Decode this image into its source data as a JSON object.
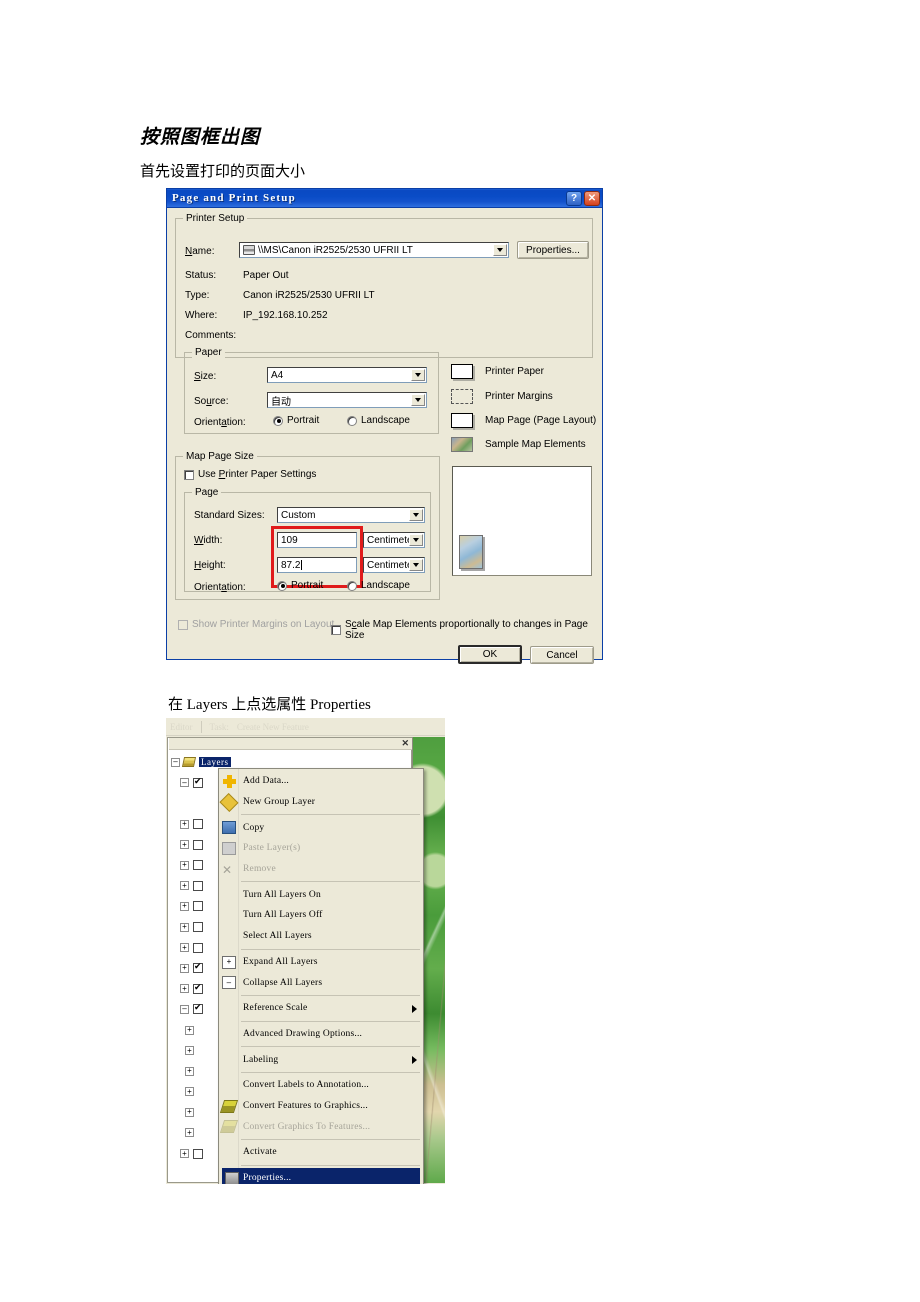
{
  "document": {
    "title": "按照图框出图",
    "line1": "首先设置打印的页面大小",
    "line2": "在 Layers 上点选属性 Properties"
  },
  "dialog": {
    "title": "Page and Print Setup",
    "help_button": "?",
    "close_button": "✕",
    "printer_setup": {
      "group_label": "Printer Setup",
      "name_label": "Name:",
      "name_value": "\\\\MS\\Canon iR2525/2530 UFRII LT",
      "properties_button": "Properties...",
      "status_label": "Status:",
      "status_value": "Paper Out",
      "type_label": "Type:",
      "type_value": "Canon iR2525/2530 UFRII LT",
      "where_label": "Where:",
      "where_value": "IP_192.168.10.252",
      "comments_label": "Comments:",
      "comments_value": ""
    },
    "paper": {
      "group_label": "Paper",
      "size_label": "Size:",
      "size_value": "A4",
      "source_label": "Source:",
      "source_value": "自动",
      "orientation_label": "Orientation:",
      "portrait_label": "Portrait",
      "landscape_label": "Landscape",
      "orientation_selected": "Portrait"
    },
    "legend": {
      "printer_paper": "Printer Paper",
      "printer_margins": "Printer Margins",
      "map_page": "Map Page (Page Layout)",
      "sample_map_elements": "Sample Map Elements"
    },
    "map_page_size": {
      "group_label": "Map Page Size",
      "use_printer_paper_settings": "Use Printer Paper Settings",
      "use_printer_paper_checked": false,
      "page_group_label": "Page",
      "standard_sizes_label": "Standard Sizes:",
      "standard_sizes_value": "Custom",
      "width_label": "Width:",
      "width_value": "109",
      "width_units": "Centimeters",
      "height_label": "Height:",
      "height_value": "87.2",
      "height_units": "Centimeters",
      "orientation_label": "Orientation:",
      "portrait_label": "Portrait",
      "landscape_label": "Landscape",
      "orientation_selected": "Portrait"
    },
    "footer": {
      "show_printer_margins": "Show Printer Margins on Layout",
      "show_printer_margins_enabled": false,
      "scale_map_elements": "Scale Map Elements proportionally to changes in Page Size",
      "scale_map_elements_checked": false,
      "ok_button": "OK",
      "cancel_button": "Cancel"
    },
    "highlight_color": "#e01b1b",
    "titlebar_color": "#0a4cc6"
  },
  "arcmap": {
    "toolbar": {
      "editor_label": "Editor",
      "task_label": "Task:",
      "task_value": "Create New Feature"
    },
    "toc": {
      "root_label": "Layers",
      "close_button": "✕",
      "rows": [
        {
          "expander": "−",
          "checkbox": "none",
          "checked": false
        },
        {
          "expander": "−",
          "checkbox": "on",
          "checked": true
        },
        {
          "expander": "",
          "checkbox": "none",
          "checked": false
        },
        {
          "expander": "+",
          "checkbox": "off",
          "checked": false
        },
        {
          "expander": "+",
          "checkbox": "off",
          "checked": false
        },
        {
          "expander": "+",
          "checkbox": "off",
          "checked": false
        },
        {
          "expander": "+",
          "checkbox": "off",
          "checked": false
        },
        {
          "expander": "+",
          "checkbox": "off",
          "checked": false
        },
        {
          "expander": "+",
          "checkbox": "off",
          "checked": false
        },
        {
          "expander": "+",
          "checkbox": "off",
          "checked": false
        },
        {
          "expander": "+",
          "checkbox": "on",
          "checked": true
        },
        {
          "expander": "+",
          "checkbox": "on",
          "checked": true
        },
        {
          "expander": "−",
          "checkbox": "on",
          "checked": true
        },
        {
          "expander": "+",
          "checkbox": "none",
          "checked": false
        },
        {
          "expander": "+",
          "checkbox": "none",
          "checked": false
        },
        {
          "expander": "+",
          "checkbox": "none",
          "checked": false
        },
        {
          "expander": "+",
          "checkbox": "none",
          "checked": false
        },
        {
          "expander": "+",
          "checkbox": "none",
          "checked": false
        },
        {
          "expander": "+",
          "checkbox": "none",
          "checked": false
        },
        {
          "expander": "+",
          "checkbox": "off",
          "checked": false
        }
      ]
    },
    "context_menu": {
      "items": [
        {
          "label": "Add Data...",
          "icon": "add-data-icon",
          "state": "normal",
          "submenu": false
        },
        {
          "label": "New Group Layer",
          "icon": "new-group-layer-icon",
          "state": "normal",
          "submenu": false
        },
        {
          "separator": true
        },
        {
          "label": "Copy",
          "icon": "copy-icon",
          "state": "normal",
          "submenu": false
        },
        {
          "label": "Paste Layer(s)",
          "icon": "paste-icon",
          "state": "disabled",
          "submenu": false
        },
        {
          "label": "Remove",
          "icon": "remove-icon",
          "state": "disabled",
          "submenu": false
        },
        {
          "separator": true
        },
        {
          "label": "Turn All Layers On",
          "icon": "",
          "state": "normal",
          "submenu": false
        },
        {
          "label": "Turn All Layers Off",
          "icon": "",
          "state": "normal",
          "submenu": false
        },
        {
          "label": "Select All Layers",
          "icon": "",
          "state": "normal",
          "submenu": false
        },
        {
          "separator": true
        },
        {
          "label": "Expand All Layers",
          "icon": "expand-all-icon",
          "state": "normal",
          "submenu": false
        },
        {
          "label": "Collapse All Layers",
          "icon": "collapse-all-icon",
          "state": "normal",
          "submenu": false
        },
        {
          "separator": true
        },
        {
          "label": "Reference Scale",
          "icon": "",
          "state": "normal",
          "submenu": true
        },
        {
          "separator": true
        },
        {
          "label": "Advanced Drawing Options...",
          "icon": "",
          "state": "normal",
          "submenu": false
        },
        {
          "separator": true
        },
        {
          "label": "Labeling",
          "icon": "",
          "state": "normal",
          "submenu": true
        },
        {
          "separator": true
        },
        {
          "label": "Convert Labels to Annotation...",
          "icon": "",
          "state": "normal",
          "submenu": false
        },
        {
          "label": "Convert Features to Graphics...",
          "icon": "convert-icon",
          "state": "normal",
          "submenu": false
        },
        {
          "label": "Convert Graphics To Features...",
          "icon": "convert-icon-disabled",
          "state": "disabled",
          "submenu": false
        },
        {
          "separator": true
        },
        {
          "label": "Activate",
          "icon": "",
          "state": "normal",
          "submenu": false
        },
        {
          "separator": true
        },
        {
          "label": "Properties...",
          "icon": "properties-icon",
          "state": "selected",
          "submenu": false
        }
      ],
      "selected_label": "Properties...",
      "selection_color": "#0a246a"
    }
  }
}
